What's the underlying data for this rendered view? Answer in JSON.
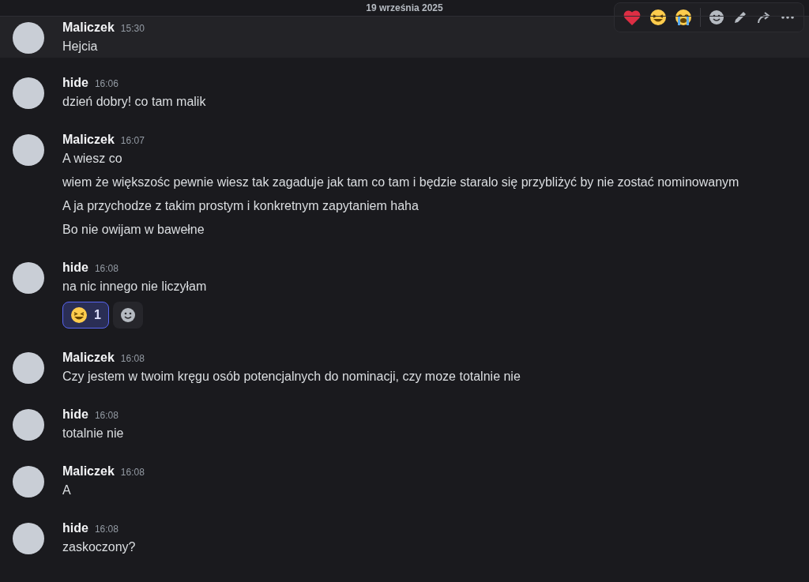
{
  "date_divider": "19 września 2025",
  "messages": [
    {
      "author": "Maliczek",
      "time": "15:30",
      "hovered": true,
      "lines": [
        "Hejcia"
      ]
    },
    {
      "author": "hide",
      "time": "16:06",
      "hovered": false,
      "lines": [
        "dzień dobry! co tam malik"
      ]
    },
    {
      "author": "Maliczek",
      "time": "16:07",
      "hovered": false,
      "lines": [
        "A wiesz co",
        "wiem że większośc pewnie wiesz tak zagaduje jak tam co tam i będzie staralo się przybliżyć by nie zostać nominowanym",
        "A ja przychodze z takim prostym i konkretnym zapytaniem haha",
        "Bo nie owijam w bawełne"
      ]
    },
    {
      "author": "hide",
      "time": "16:08",
      "hovered": false,
      "lines": [
        "na nic innego nie liczyłam"
      ],
      "reactions": [
        {
          "count": "1",
          "selected": true
        }
      ]
    },
    {
      "author": "Maliczek",
      "time": "16:08",
      "hovered": false,
      "lines": [
        "Czy jestem w twoim kręgu osób potencjalnych do nominacji, czy moze totalnie nie"
      ]
    },
    {
      "author": "hide",
      "time": "16:08",
      "hovered": false,
      "lines": [
        "totalnie nie"
      ]
    },
    {
      "author": "Maliczek",
      "time": "16:08",
      "hovered": false,
      "lines": [
        "A"
      ]
    },
    {
      "author": "hide",
      "time": "16:08",
      "hovered": false,
      "lines": [
        "zaskoczony?"
      ]
    }
  ]
}
